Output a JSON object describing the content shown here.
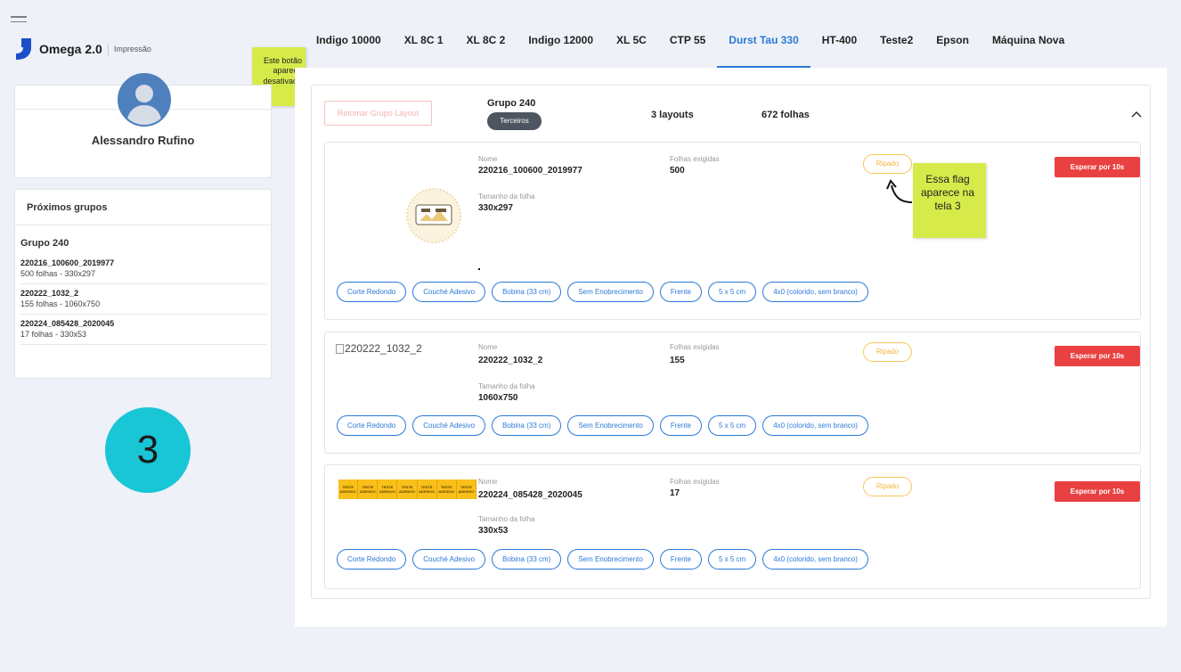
{
  "app": {
    "name": "Omega 2.0",
    "section": "Impressão"
  },
  "notes": {
    "disabled_button": "Este botão aparece desativado",
    "flag": "Essa flag aparece na tela 3"
  },
  "user": {
    "name": "Alessandro Rufino"
  },
  "next_groups": {
    "title": "Próximos grupos",
    "group": "Grupo 240",
    "items": [
      {
        "name": "220216_100600_2019977",
        "detail": "500 folhas - 330x297"
      },
      {
        "name": "220222_1032_2",
        "detail": "155 folhas - 1060x750"
      },
      {
        "name": "220224_085428_2020045",
        "detail": "17 folhas - 330x53"
      }
    ]
  },
  "step_number": "3",
  "tabs": [
    {
      "label": "Indigo 10000",
      "active": false
    },
    {
      "label": "XL 8C 1",
      "active": false
    },
    {
      "label": "XL 8C 2",
      "active": false
    },
    {
      "label": "Indigo 12000",
      "active": false
    },
    {
      "label": "XL 5C",
      "active": false
    },
    {
      "label": "CTP 55",
      "active": false
    },
    {
      "label": "Durst Tau 330",
      "active": true
    },
    {
      "label": "HT-400",
      "active": false
    },
    {
      "label": "Teste2",
      "active": false
    },
    {
      "label": "Epson",
      "active": false
    },
    {
      "label": "Máquina Nova",
      "active": false
    }
  ],
  "group": {
    "resume_label": "Retomar Grupo Layout",
    "name": "Grupo 240",
    "chip": "Terceiros",
    "layouts": "3 layouts",
    "sheets": "672 folhas",
    "labels": {
      "name": "Nome",
      "sheets_required": "Folhas exigidas",
      "sheet_size": "Tamanho da folha"
    },
    "ripado_label": "Ripado",
    "wait_label": "Esperar por 10s",
    "layouts_list": [
      {
        "name": "220216_100600_2019977",
        "sheets": "500",
        "size": "330x297",
        "tags": [
          "Corte Redondo",
          "Couché Adesivo",
          "Bobina (33 cm)",
          "Sem Enobrecimento",
          "Frente",
          "5 x 5 cm",
          "4x0 (colorido, sem branco)"
        ]
      },
      {
        "name": "220222_1032_2",
        "sheets": "155",
        "size": "1060x750",
        "image_alt": "220222_1032_2",
        "tags": [
          "Corte Redondo",
          "Couché Adesivo",
          "Bobina (33 cm)",
          "Sem Enobrecimento",
          "Frente",
          "5 x 5 cm",
          "4x0 (colorido, sem branco)"
        ]
      },
      {
        "name": "220224_085428_2020045",
        "sheets": "17",
        "size": "330x53",
        "label_strip": [
          "TESTE ADESIVO",
          "TESTE ADESIVO",
          "TESTE ADESIVO",
          "TESTE ADESIVO",
          "TESTE ADESIVO",
          "TESTE ADESIVO",
          "TESTE ADESIVO"
        ],
        "tags": [
          "Corte Redondo",
          "Couché Adesivo",
          "Bobina (33 cm)",
          "Sem Enobrecimento",
          "Frente",
          "5 x 5 cm",
          "4x0 (colorido, sem branco)"
        ]
      }
    ]
  },
  "colors": {
    "accent": "#2b7ad8",
    "danger": "#e94141",
    "warning": "#f3b53f",
    "sticky": "#d6eb4a",
    "step": "#19c6d6"
  }
}
